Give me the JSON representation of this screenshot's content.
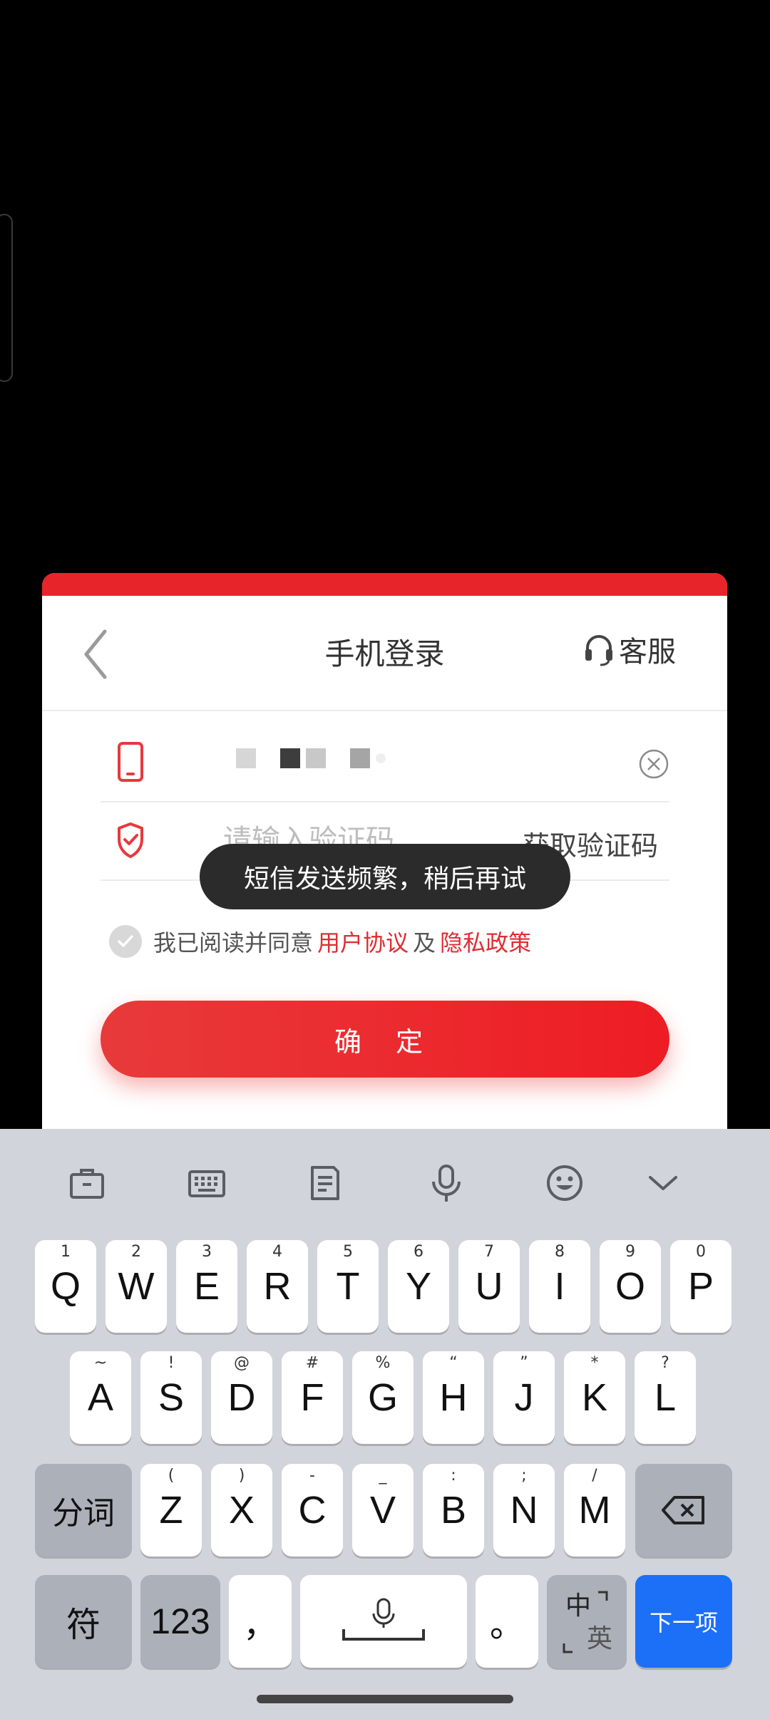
{
  "dialog": {
    "title": "手机登录",
    "service_label": "客服",
    "code_placeholder": "请输入验证码",
    "get_code_label": "获取验证码",
    "agree_prefix": "我已阅读并同意",
    "user_agreement": "用户协议",
    "and_word": "及",
    "privacy_policy": "隐私政策",
    "confirm_label": "确 定",
    "agree_checked": true
  },
  "toast": {
    "text": "短信发送频繁，稍后再试"
  },
  "keyboard": {
    "toolbar_icons": [
      "briefcase-icon",
      "keyboard-icon",
      "clipboard-icon",
      "microphone-icon",
      "emoji-icon",
      "chevron-down-icon"
    ],
    "row1": [
      {
        "main": "Q",
        "sub": "1"
      },
      {
        "main": "W",
        "sub": "2"
      },
      {
        "main": "E",
        "sub": "3"
      },
      {
        "main": "R",
        "sub": "4"
      },
      {
        "main": "T",
        "sub": "5"
      },
      {
        "main": "Y",
        "sub": "6"
      },
      {
        "main": "U",
        "sub": "7"
      },
      {
        "main": "I",
        "sub": "8"
      },
      {
        "main": "O",
        "sub": "9"
      },
      {
        "main": "P",
        "sub": "0"
      }
    ],
    "row2": [
      {
        "main": "A",
        "sub": "~"
      },
      {
        "main": "S",
        "sub": "!"
      },
      {
        "main": "D",
        "sub": "@"
      },
      {
        "main": "F",
        "sub": "#"
      },
      {
        "main": "G",
        "sub": "%"
      },
      {
        "main": "H",
        "sub": "“"
      },
      {
        "main": "J",
        "sub": "”"
      },
      {
        "main": "K",
        "sub": "*"
      },
      {
        "main": "L",
        "sub": "?"
      }
    ],
    "row3": [
      {
        "main": "Z",
        "sub": "("
      },
      {
        "main": "X",
        "sub": ")"
      },
      {
        "main": "C",
        "sub": "-"
      },
      {
        "main": "V",
        "sub": "_"
      },
      {
        "main": "B",
        "sub": ":"
      },
      {
        "main": "N",
        "sub": ";"
      },
      {
        "main": "M",
        "sub": "/"
      }
    ],
    "segment_label": "分词",
    "symbol_label": "符",
    "num_label": "123",
    "comma_label": "，",
    "period_label": "。",
    "lang_top": "中",
    "lang_bottom": "英",
    "next_label": "下一项"
  },
  "colors": {
    "accent": "#e8242b",
    "enter": "#1c6ff7"
  }
}
